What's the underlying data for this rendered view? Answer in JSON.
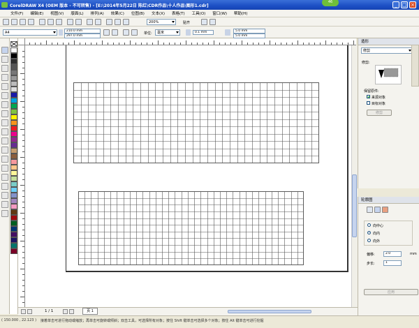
{
  "window": {
    "title": "CorelDRAW X4 (OEM 版本 - 不可转售) - [E:\\2014年5月22日 陈红\\CDR作品\\十人作品\\图形1.cdr]",
    "badge": "46"
  },
  "menu": [
    "文件(F)",
    "编辑(E)",
    "视图(V)",
    "版面(L)",
    "排列(A)",
    "效果(C)",
    "位图(B)",
    "文本(X)",
    "表格(T)",
    "工具(O)",
    "窗口(W)",
    "帮助(H)"
  ],
  "toolbar": {
    "zoom": "200%",
    "snap": "贴齐"
  },
  "propbar": {
    "paper": "A4",
    "width": "210.0 mm",
    "height": "297.0 mm",
    "unit_label": "单位:",
    "unit": "毫米",
    "nudge": "0.1 mm",
    "dup_x": "5.0 mm",
    "dup_y": "5.0 mm"
  },
  "palette_colors": [
    "#ffffff",
    "#000000",
    "#2f2f2f",
    "#555555",
    "#777777",
    "#999999",
    "#bbbbbb",
    "#dddddd",
    "#1a1aa8",
    "#00a3e0",
    "#00a651",
    "#7fc241",
    "#fff200",
    "#f7941d",
    "#ed1c24",
    "#ec008c",
    "#92278f",
    "#662d91",
    "#c69c6d",
    "#8b5e3c",
    "#f6989d",
    "#fdc689",
    "#fff799",
    "#c4df9b",
    "#7accc8",
    "#6dcff6",
    "#8393ca",
    "#a186be",
    "#f49ac1",
    "#603913",
    "#9e0b0f",
    "#005e20",
    "#003471",
    "#440e62",
    "#1b1464",
    "#00746b",
    "#7a0026"
  ],
  "trim_docker": {
    "title": "造形",
    "mode": "修剪",
    "preview_label": "修剪:",
    "keep_label": "保留原件:",
    "source_object": "来源对象",
    "target_object": "目标对象",
    "source_checked": true,
    "target_checked": false,
    "apply": "修剪"
  },
  "contour_docker": {
    "title": "轮廓图",
    "options": [
      "向中心",
      "向内",
      "向外"
    ],
    "selected": 1,
    "offset_label": "偏移:",
    "offset_value": "2.0",
    "offset_unit": "mm",
    "steps_label": "步长:",
    "steps_value": "1",
    "apply": "应用"
  },
  "status": {
    "page": "1 / 1",
    "page_tab": "页 1",
    "coords": "( 150.000 , 22.123 )",
    "hint": "接着单击可进行拖动或缩放；再单击可旋转或倾斜；双击工具，可选择所有对象；按住 Shift 键单击可选择多个对象；按住 Alt 键单击可进行挖掘"
  },
  "grids": [
    {
      "rows": 11,
      "cols": 33
    },
    {
      "rows": 11,
      "cols": 35
    }
  ]
}
